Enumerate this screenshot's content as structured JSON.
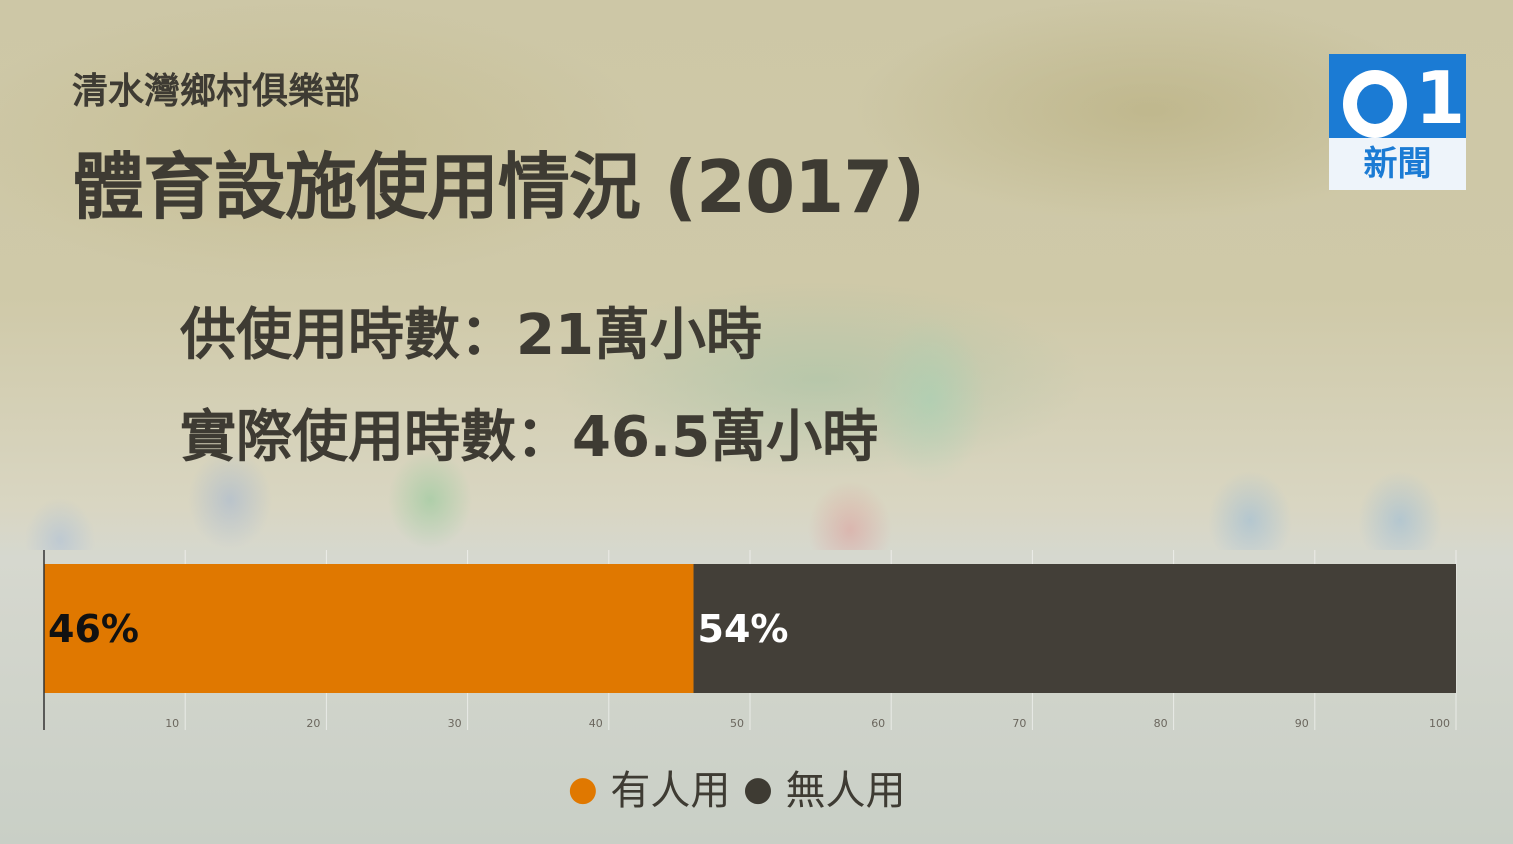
{
  "header": {
    "subtitle": "清水灣鄉村俱樂部",
    "title": "體育設施使用情況 (2017)"
  },
  "stats": {
    "available_hours": "供使用時數：21萬小時",
    "actual_hours": "實際使用時數：46.5萬小時"
  },
  "logo": {
    "mark": "01",
    "text": "新聞",
    "colors": {
      "primary": "#1b7bd4",
      "bottom": "#eef4fa"
    }
  },
  "chart_data": {
    "type": "bar",
    "orientation": "horizontal",
    "stacked": true,
    "xlim": [
      0,
      100
    ],
    "x_ticks": [
      10,
      20,
      30,
      40,
      50,
      60,
      70,
      80,
      90,
      100
    ],
    "grid": true,
    "legend_position": "bottom",
    "series": [
      {
        "name": "有人用",
        "value": 46,
        "label": "46%",
        "color": "#e07800",
        "label_color": "#111111"
      },
      {
        "name": "無人用",
        "value": 54,
        "label": "54%",
        "color": "#433f38",
        "label_color": "#ffffff"
      }
    ]
  },
  "legend": {
    "dot": "●",
    "items": [
      "有人用",
      "無人用"
    ]
  }
}
